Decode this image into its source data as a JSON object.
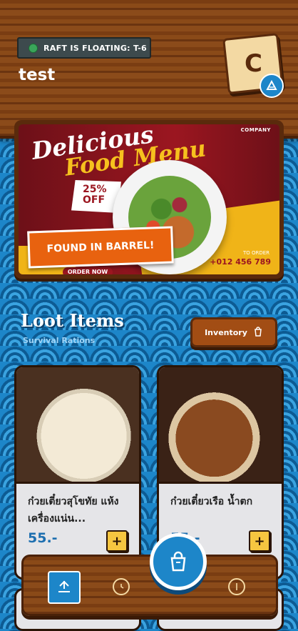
{
  "header": {
    "status_text": "RAFT IS FLOATING: T-6",
    "player_name": "test",
    "avatar_letter": "C",
    "avatar_badge_icon": "raft-icon"
  },
  "banner": {
    "company": "COMPANY",
    "title_line1": "Delicious",
    "title_line2": "Food Menu",
    "discount": "25%",
    "discount_suffix": "OFF",
    "order_label": "ORDER NOW",
    "phone_label": "TO ORDER",
    "phone": "+012 456 789",
    "found_badge": "FOUND IN BARREL!"
  },
  "loot": {
    "title": "Loot Items",
    "subtitle": "Survival Rations",
    "inventory_label": "Inventory",
    "inventory_icon": "bag-icon"
  },
  "items": [
    {
      "name": "ก๋วยเตี๋ยวสุโขทัย แห้ง เครื่องแน่น...",
      "price": "55.-",
      "add_label": "+"
    },
    {
      "name": "ก๋วยเตี๋ยวเรือ น้ำตก",
      "price": "55.-",
      "add_label": "+"
    }
  ],
  "nav": {
    "home_icon": "raft-icon",
    "history_icon": "clock-icon",
    "cart_icon": "bag-icon",
    "coins_icon": "coin-icon"
  },
  "colors": {
    "sea": "#1d86c9",
    "wood": "#8a4a18",
    "accent_orange": "#e8620f",
    "price_blue": "#1d6fb0",
    "add_yellow": "#f6c640"
  }
}
